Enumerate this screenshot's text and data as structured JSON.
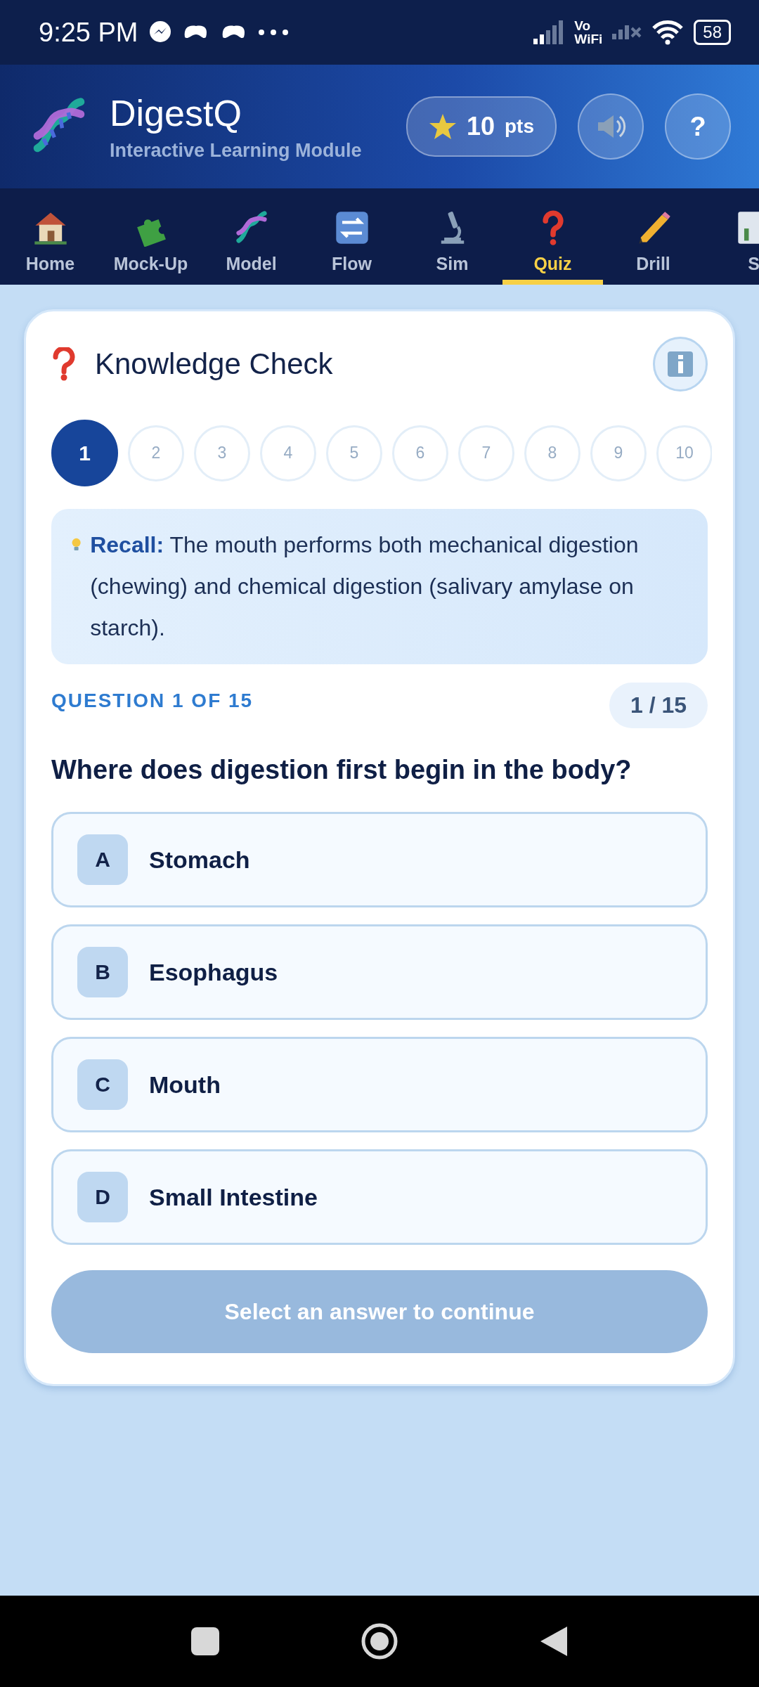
{
  "status_bar": {
    "time": "9:25 PM",
    "vowifi_top": "Vo",
    "vowifi_bottom": "WiFi",
    "battery": "58"
  },
  "header": {
    "title": "DigestQ",
    "subtitle": "Interactive Learning Module",
    "points_value": "10",
    "points_unit": "pts",
    "help_label": "?"
  },
  "nav_tabs": [
    {
      "label": "Home",
      "selected": false
    },
    {
      "label": "Mock-Up",
      "selected": false
    },
    {
      "label": "Model",
      "selected": false
    },
    {
      "label": "Flow",
      "selected": false
    },
    {
      "label": "Sim",
      "selected": false
    },
    {
      "label": "Quiz",
      "selected": true
    },
    {
      "label": "Drill",
      "selected": false
    },
    {
      "label": "S",
      "selected": false
    }
  ],
  "card": {
    "title": "Knowledge Check",
    "steps": [
      {
        "label": "1",
        "selected": true
      },
      {
        "label": "2",
        "selected": false
      },
      {
        "label": "3",
        "selected": false
      },
      {
        "label": "4",
        "selected": false
      },
      {
        "label": "5",
        "selected": false
      },
      {
        "label": "6",
        "selected": false
      },
      {
        "label": "7",
        "selected": false
      },
      {
        "label": "8",
        "selected": false
      },
      {
        "label": "9",
        "selected": false
      },
      {
        "label": "10",
        "selected": false
      }
    ],
    "hint": "**Recall:** The mouth performs both mechanical digestion (chewing) and chemical digestion (salivary amylase on starch).",
    "question_label": "QUESTION 1 OF 15",
    "counter": "1 / 15",
    "question": "Where does digestion first begin in the body?",
    "options": [
      {
        "letter": "A",
        "text": "Stomach",
        "selected": false
      },
      {
        "letter": "B",
        "text": "Esophagus",
        "selected": false
      },
      {
        "letter": "C",
        "text": "Mouth",
        "selected": false
      },
      {
        "letter": "D",
        "text": "Small Intestine",
        "selected": false
      }
    ],
    "continue_button": {
      "label": "Select an answer to continue",
      "disabled": true
    }
  }
}
